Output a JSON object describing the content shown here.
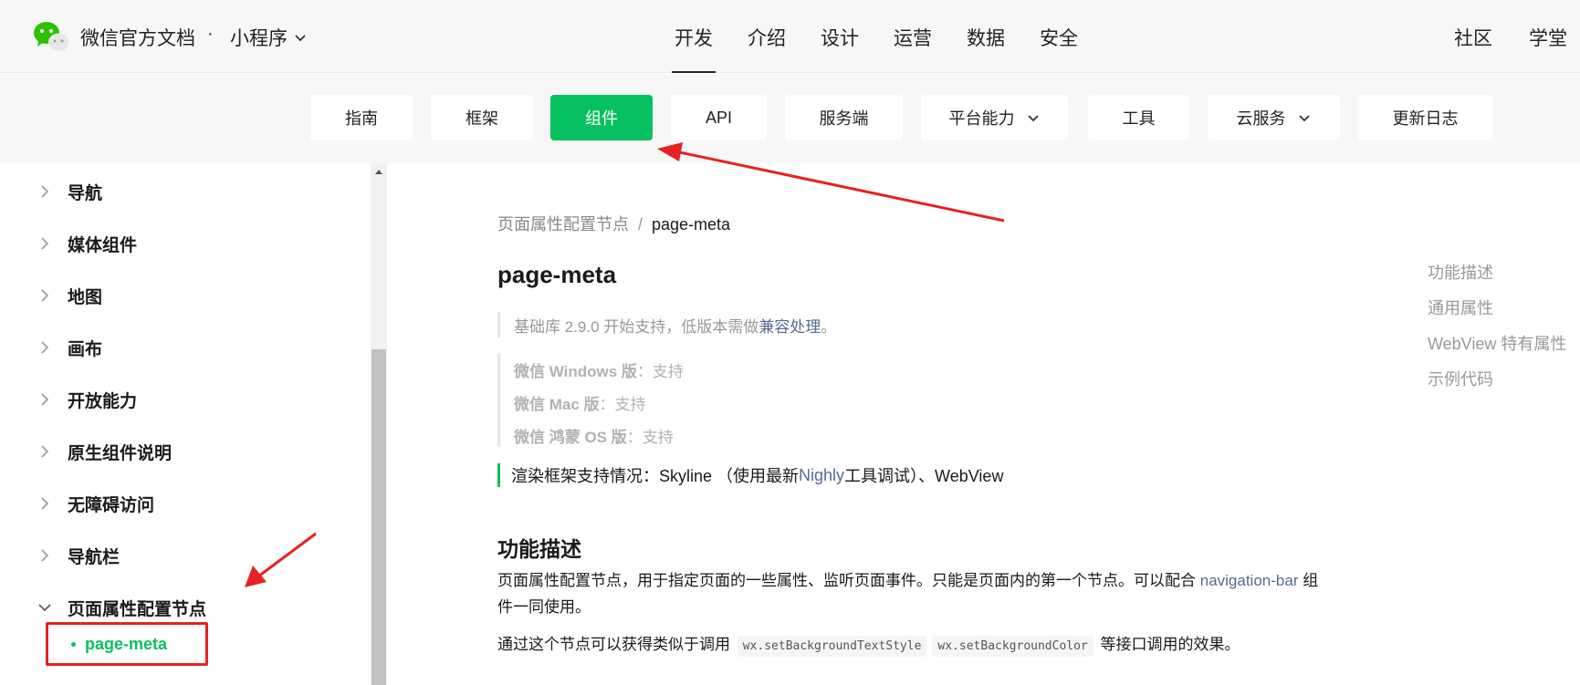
{
  "header": {
    "brand": "微信官方文档",
    "separator": "·",
    "product": "小程序",
    "nav": [
      "开发",
      "介绍",
      "设计",
      "运营",
      "数据",
      "安全"
    ],
    "active_nav": "开发",
    "right_nav": [
      "社区",
      "学堂"
    ]
  },
  "tabs": [
    {
      "label": "指南"
    },
    {
      "label": "框架"
    },
    {
      "label": "组件",
      "active": true
    },
    {
      "label": "API"
    },
    {
      "label": "服务端"
    },
    {
      "label": "平台能力",
      "has_dropdown": true
    },
    {
      "label": "工具"
    },
    {
      "label": "云服务",
      "has_dropdown": true
    },
    {
      "label": "更新日志"
    }
  ],
  "sidebar": {
    "items": [
      {
        "label": "导航"
      },
      {
        "label": "媒体组件"
      },
      {
        "label": "地图"
      },
      {
        "label": "画布"
      },
      {
        "label": "开放能力"
      },
      {
        "label": "原生组件说明"
      },
      {
        "label": "无障碍访问"
      },
      {
        "label": "导航栏"
      },
      {
        "label": "页面属性配置节点",
        "expanded": true
      }
    ],
    "active_sub_item": "page-meta"
  },
  "breadcrumb": {
    "parent": "页面属性配置节点",
    "separator": "/",
    "current": "page-meta"
  },
  "page": {
    "title": "page-meta",
    "version_note": {
      "prefix": "基础库 2.9.0 开始支持，低版本需做",
      "link": "兼容处理",
      "suffix": "。"
    },
    "support": [
      {
        "platform": "微信 Windows 版",
        "value": "：支持"
      },
      {
        "platform": "微信 Mac 版",
        "value": "：支持"
      },
      {
        "platform": "微信 鸿蒙 OS 版",
        "value": "：支持"
      }
    ],
    "render": {
      "prefix": "渲染框架支持情况：Skyline （使用最新 ",
      "link": "Nighly",
      "suffix": " 工具调试）、WebView"
    },
    "section_title": "功能描述",
    "para1": {
      "text": "页面属性配置节点，用于指定页面的一些属性、监听页面事件。只能是页面内的第一个节点。可以配合 ",
      "link": "navigation-bar",
      "suffix": " 组件一同使用。"
    },
    "para2": {
      "prefix": "通过这个节点可以获得类似于调用 ",
      "code1": "wx.setBackgroundTextStyle",
      "code2": "wx.setBackgroundColor",
      "suffix": " 等接口调用的效果。"
    }
  },
  "toc": [
    "功能描述",
    "通用属性",
    "WebView 特有属性",
    "示例代码"
  ],
  "colors": {
    "accent": "#07c160",
    "link": "#576b95",
    "annotation": "#e62222"
  }
}
